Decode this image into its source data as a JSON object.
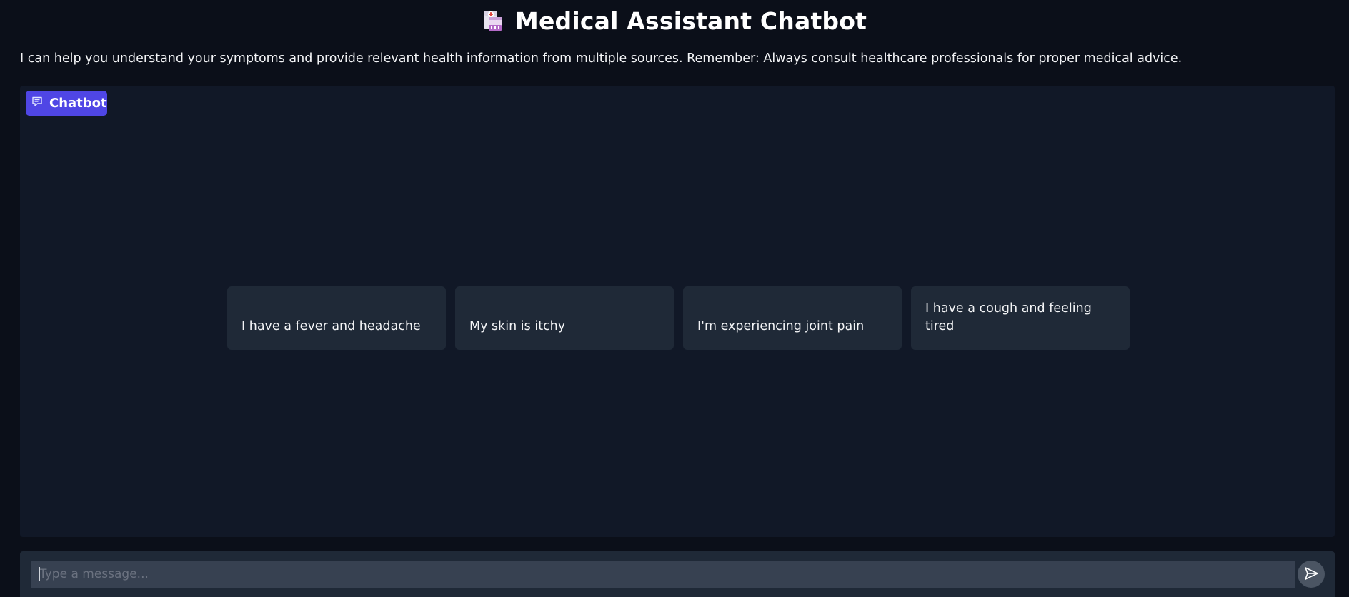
{
  "header": {
    "icon": "hospital-icon",
    "title": "Medical Assistant Chatbot"
  },
  "description": "I can help you understand your symptoms and provide relevant health information from multiple sources. Remember: Always consult healthcare professionals for proper medical advice.",
  "chatbot": {
    "label": "Chatbot",
    "label_icon": "chat-bubble-icon",
    "examples": [
      "I have a fever and headache",
      "My skin is itchy",
      "I'm experiencing joint pain",
      "I have a cough and feeling tired"
    ]
  },
  "input": {
    "placeholder": "Type a message...",
    "value": "",
    "send_icon": "send-icon"
  },
  "colors": {
    "accent": "#4f46e5",
    "background": "#0b0f19",
    "panel": "#111827",
    "card": "#1f2937",
    "input": "#374151"
  }
}
